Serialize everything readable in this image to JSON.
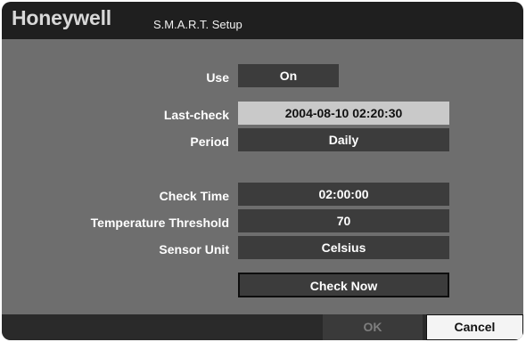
{
  "window": {
    "brand": "Honeywell",
    "title": "S.M.A.R.T. Setup"
  },
  "form": {
    "use": {
      "label": "Use",
      "value": "On"
    },
    "last_check": {
      "label": "Last-check",
      "value": "2004-08-10 02:20:30"
    },
    "period": {
      "label": "Period",
      "value": "Daily"
    },
    "check_time": {
      "label": "Check Time",
      "value": "02:00:00"
    },
    "temperature_threshold": {
      "label": "Temperature Threshold",
      "value": "70"
    },
    "sensor_unit": {
      "label": "Sensor Unit",
      "value": "Celsius"
    },
    "check_now_label": "Check Now"
  },
  "footer": {
    "ok_label": "OK",
    "cancel_label": "Cancel"
  }
}
